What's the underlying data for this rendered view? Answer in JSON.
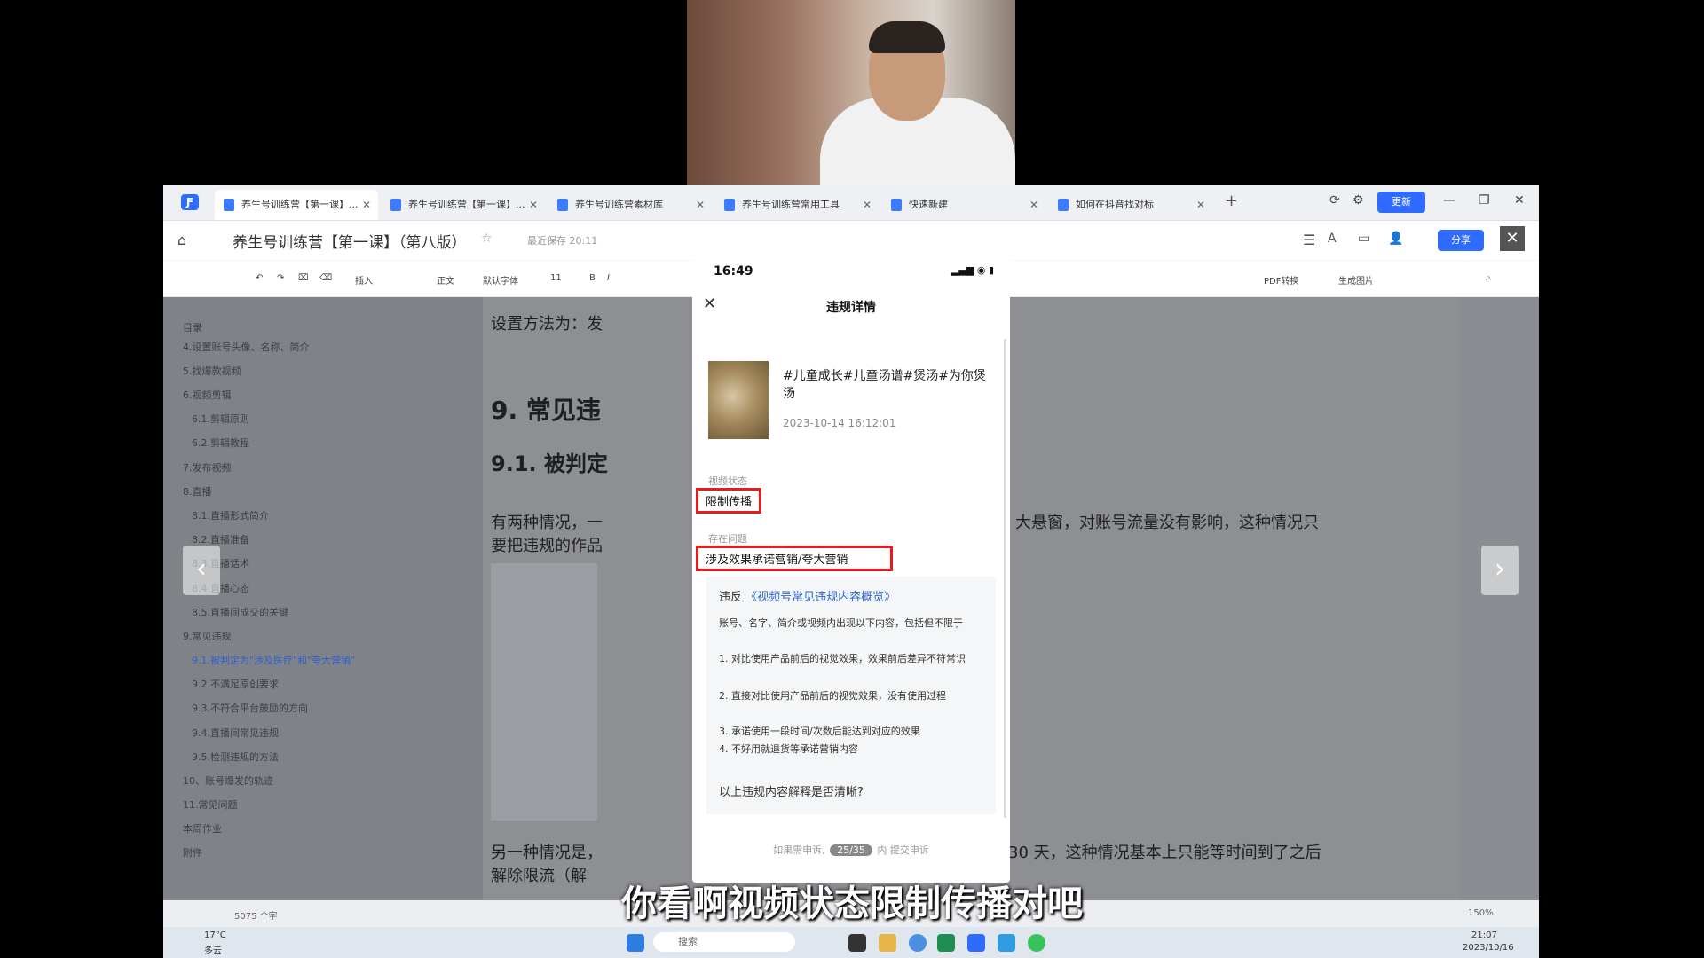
{
  "tabs": [
    {
      "label": "养生号训练营【第一课】...",
      "active": true
    },
    {
      "label": "养生号训练营【第一课】...",
      "active": false
    },
    {
      "label": "养生号训练营素材库",
      "active": false
    },
    {
      "label": "养生号训练营常用工具",
      "active": false
    },
    {
      "label": "快速新建",
      "active": false
    },
    {
      "label": "如何在抖音找对标",
      "active": false
    }
  ],
  "window": {
    "update_label": "更新"
  },
  "titlebar": {
    "doc_title": "养生号训练营【第一课】（第八版）",
    "save_status": "最近保存 20:11",
    "share_label": "分享"
  },
  "toolbar": {
    "insert": "插入",
    "style": "正文",
    "font": "默认字体",
    "size": "11",
    "pdf": "PDF转换",
    "image": "生成图片"
  },
  "toc": {
    "header": "目录",
    "items": [
      "4.设置账号头像、名称、简介",
      "5.找爆款视频",
      "6.视频剪辑",
      "6.1.剪辑原则",
      "6.2.剪辑教程",
      "7.发布视频",
      "8.直播",
      "8.1.直播形式简介",
      "8.2.直播准备",
      "8.3.直播话术",
      "8.4.直播心态",
      "8.5.直播间成交的关键",
      "9.常见违规",
      "9.1.被判定为\"涉及医疗\"和\"夸大营销\"",
      "9.2.不满足原创要求",
      "9.3.不符合平台鼓励的方向",
      "9.4.直播间常见违规",
      "9.5.检测违规的方法",
      "10、账号爆发的轨迹",
      "11.常见问题",
      "本周作业",
      "附件"
    ]
  },
  "page": {
    "line1": "设置方法为：发",
    "h1": "9.  常见违",
    "h2": "9.1.  被判定",
    "para1a": "有两种情况，一",
    "para1b": "大悬窗，对账号流量没有影响，这种情况只",
    "para1c": "要把违规的作品",
    "para2a": "另一种情况是，",
    "para2b": "30 天，这种情况基本上只能等时间到了之后",
    "para2c": "解除限流（解"
  },
  "statusbar": {
    "words": "5075 个字",
    "zoom": "150%"
  },
  "taskbar": {
    "weather_temp": "17°C",
    "weather_desc": "多云",
    "search": "搜索",
    "time": "21:07",
    "date": "2023/10/16"
  },
  "phone": {
    "time": "16:49",
    "title": "违规详情",
    "video_title": "#儿童成长#儿童汤谱#煲汤#为你煲汤",
    "video_time": "2023-10-14 16:12:01",
    "status_label": "视频状态",
    "status_value": "限制传播",
    "issue_label": "存在问题",
    "issue_value": "涉及效果承诺营销/夸大营销",
    "violation_prefix": "违反",
    "violation_link": "《视频号常见违规内容概览》",
    "violation_lines": [
      "账号、名字、简介或视频内出现以下内容，包括但不限于",
      "1. 对比使用产品前后的视觉效果，效果前后差异不符常识",
      "2. 直接对比使用产品前后的视觉效果，没有使用过程",
      "3. 承诺使用一段时间/次数后能达到对应的效果",
      "4. 不好用就退货等承诺营销内容"
    ],
    "question": "以上违规内容解释是否清晰?",
    "appeal_prefix": "如果需申诉,",
    "page_indicator": "25/35",
    "appeal_suffix": "内 提交申诉"
  },
  "subtitle": "你看啊视频状态限制传播对吧"
}
